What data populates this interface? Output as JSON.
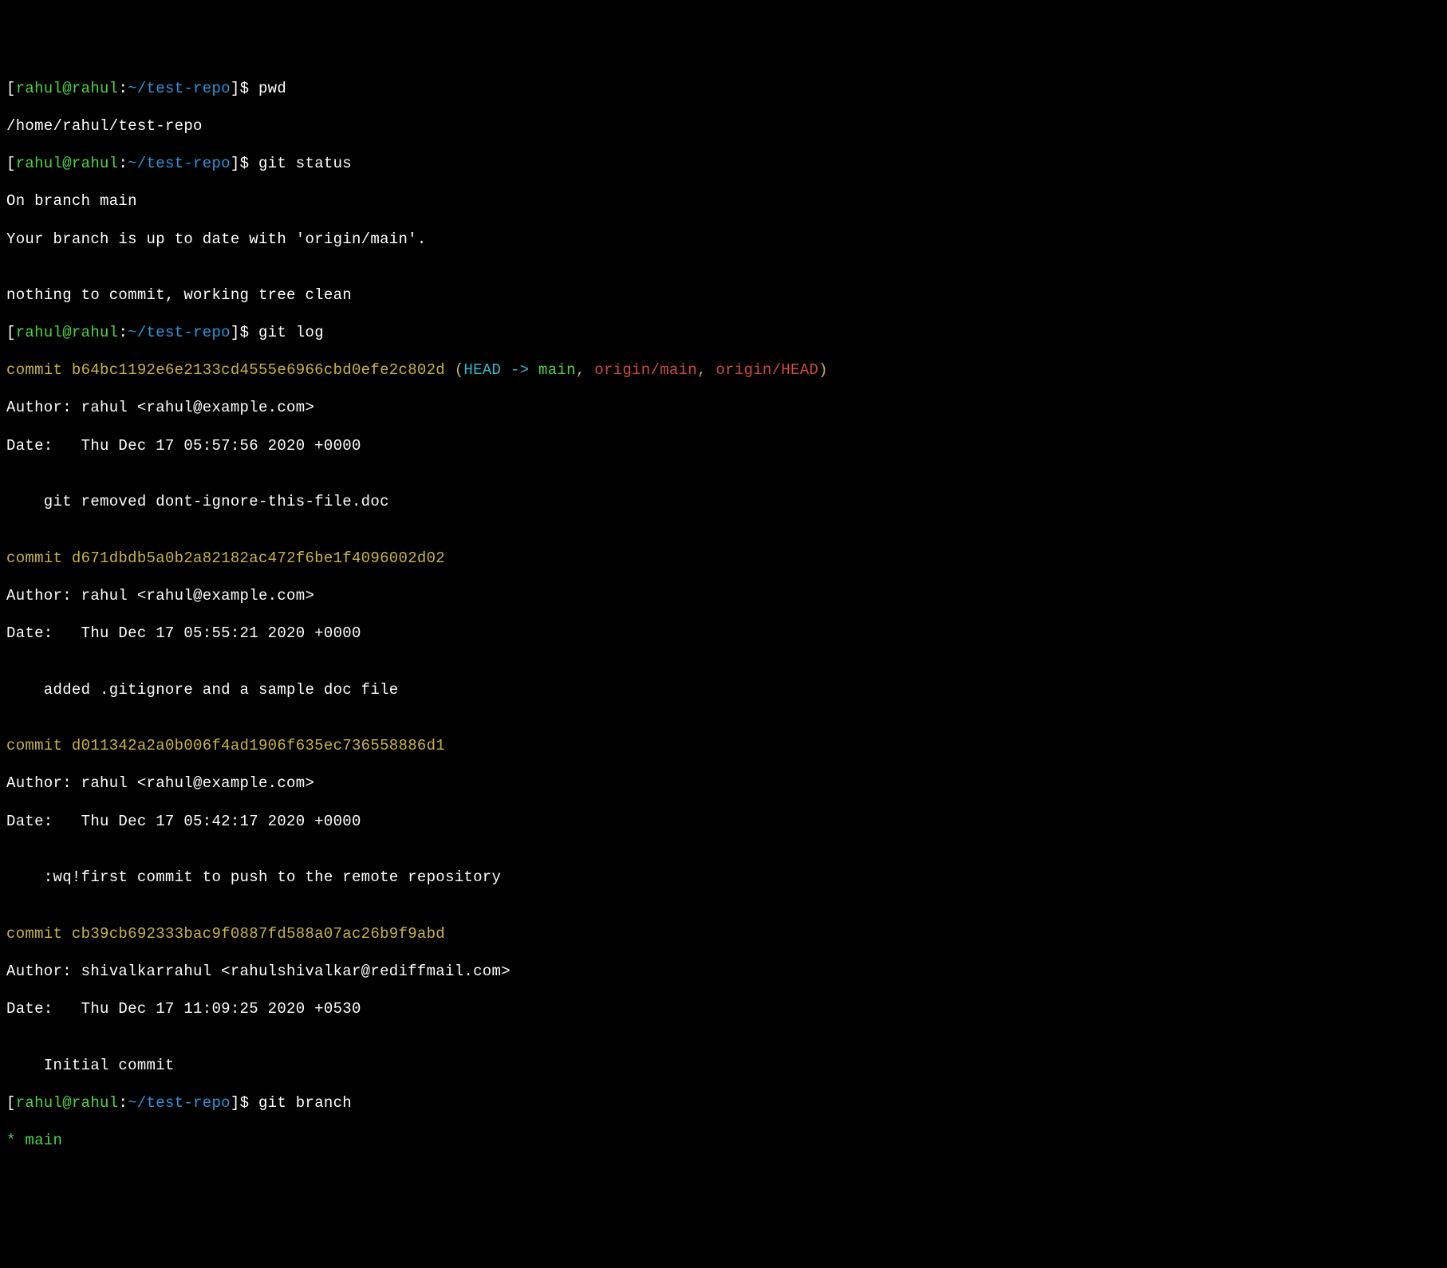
{
  "prompt": {
    "bracket_open": "[",
    "user": "rahul@rahul",
    "sep": ":",
    "path": "~/test-repo",
    "bracket_close": "]",
    "dollar": "$"
  },
  "lines": {
    "cmd_pwd": "pwd",
    "out_pwd": "/home/rahul/test-repo",
    "cmd_status": "git status",
    "status_branch": "On branch main",
    "status_uptodate": "Your branch is up to date with 'origin/main'.",
    "status_clean": "nothing to commit, working tree clean",
    "cmd_log": "git log",
    "commit1_prefix": "commit ",
    "commit1_hash": "b64bc1192e6e2133cd4555e6966cbd0efe2c802d",
    "commit1_paren_open": " (",
    "commit1_head": "HEAD -> ",
    "commit1_main": "main",
    "commit1_comma1": ", ",
    "commit1_origin_main": "origin/main",
    "commit1_comma2": ", ",
    "commit1_origin_head": "origin/HEAD",
    "commit1_paren_close": ")",
    "commit1_author": "Author: rahul <rahul@example.com>",
    "commit1_date": "Date:   Thu Dec 17 05:57:56 2020 +0000",
    "commit1_msg": "    git removed dont-ignore-this-file.doc",
    "commit2_prefix": "commit ",
    "commit2_hash": "d671dbdb5a0b2a82182ac472f6be1f4096002d02",
    "commit2_author": "Author: rahul <rahul@example.com>",
    "commit2_date": "Date:   Thu Dec 17 05:55:21 2020 +0000",
    "commit2_msg": "    added .gitignore and a sample doc file",
    "commit3_prefix": "commit ",
    "commit3_hash": "d011342a2a0b006f4ad1906f635ec736558886d1",
    "commit3_author": "Author: rahul <rahul@example.com>",
    "commit3_date": "Date:   Thu Dec 17 05:42:17 2020 +0000",
    "commit3_msg": "    :wq!first commit to push to the remote repository",
    "commit4_prefix": "commit ",
    "commit4_hash": "cb39cb692333bac9f0887fd588a07ac26b9f9abd",
    "commit4_author": "Author: shivalkarrahul <rahulshivalkar@rediffmail.com>",
    "commit4_date": "Date:   Thu Dec 17 11:09:25 2020 +0530",
    "commit4_msg": "    Initial commit",
    "cmd_branch": "git branch",
    "branch_star": "* ",
    "branch_main": "main",
    "blank": ""
  }
}
